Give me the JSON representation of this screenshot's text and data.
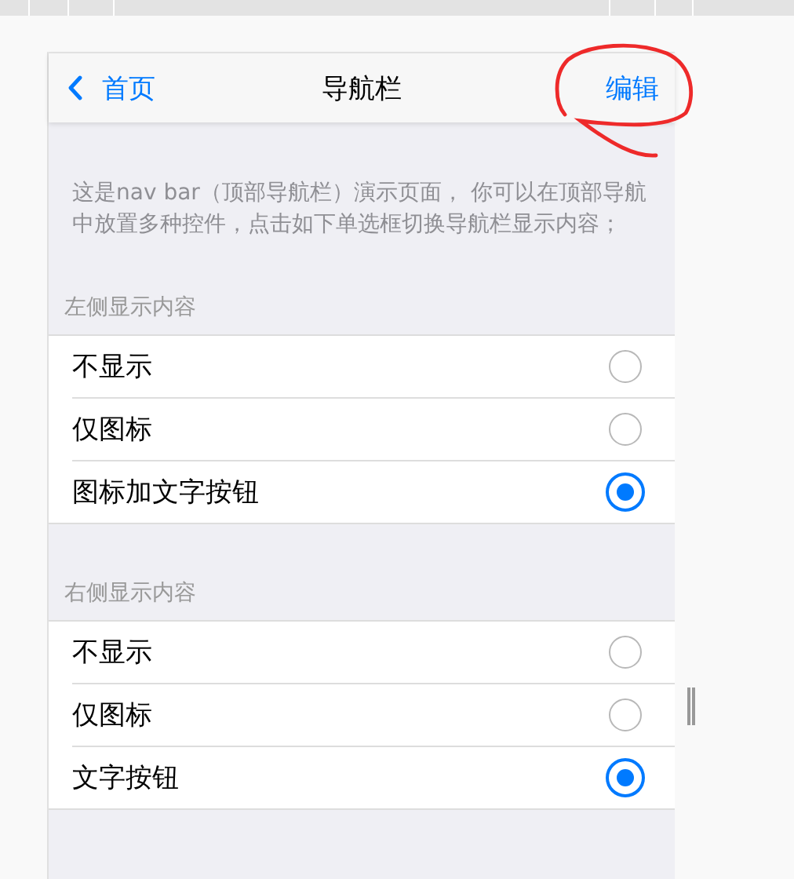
{
  "nav": {
    "back_label": "首页",
    "title": "导航栏",
    "right_label": "编辑"
  },
  "description": "这是nav bar（顶部导航栏）演示页面， 你可以在顶部导航中放置多种控件，点击如下单选框切换导航栏显示内容；",
  "groups": [
    {
      "header": "左侧显示内容",
      "options": [
        {
          "label": "不显示",
          "selected": false
        },
        {
          "label": "仅图标",
          "selected": false
        },
        {
          "label": "图标加文字按钮",
          "selected": true
        }
      ]
    },
    {
      "header": "右侧显示内容",
      "options": [
        {
          "label": "不显示",
          "selected": false
        },
        {
          "label": "仅图标",
          "selected": false
        },
        {
          "label": "文字按钮",
          "selected": true
        }
      ]
    }
  ]
}
